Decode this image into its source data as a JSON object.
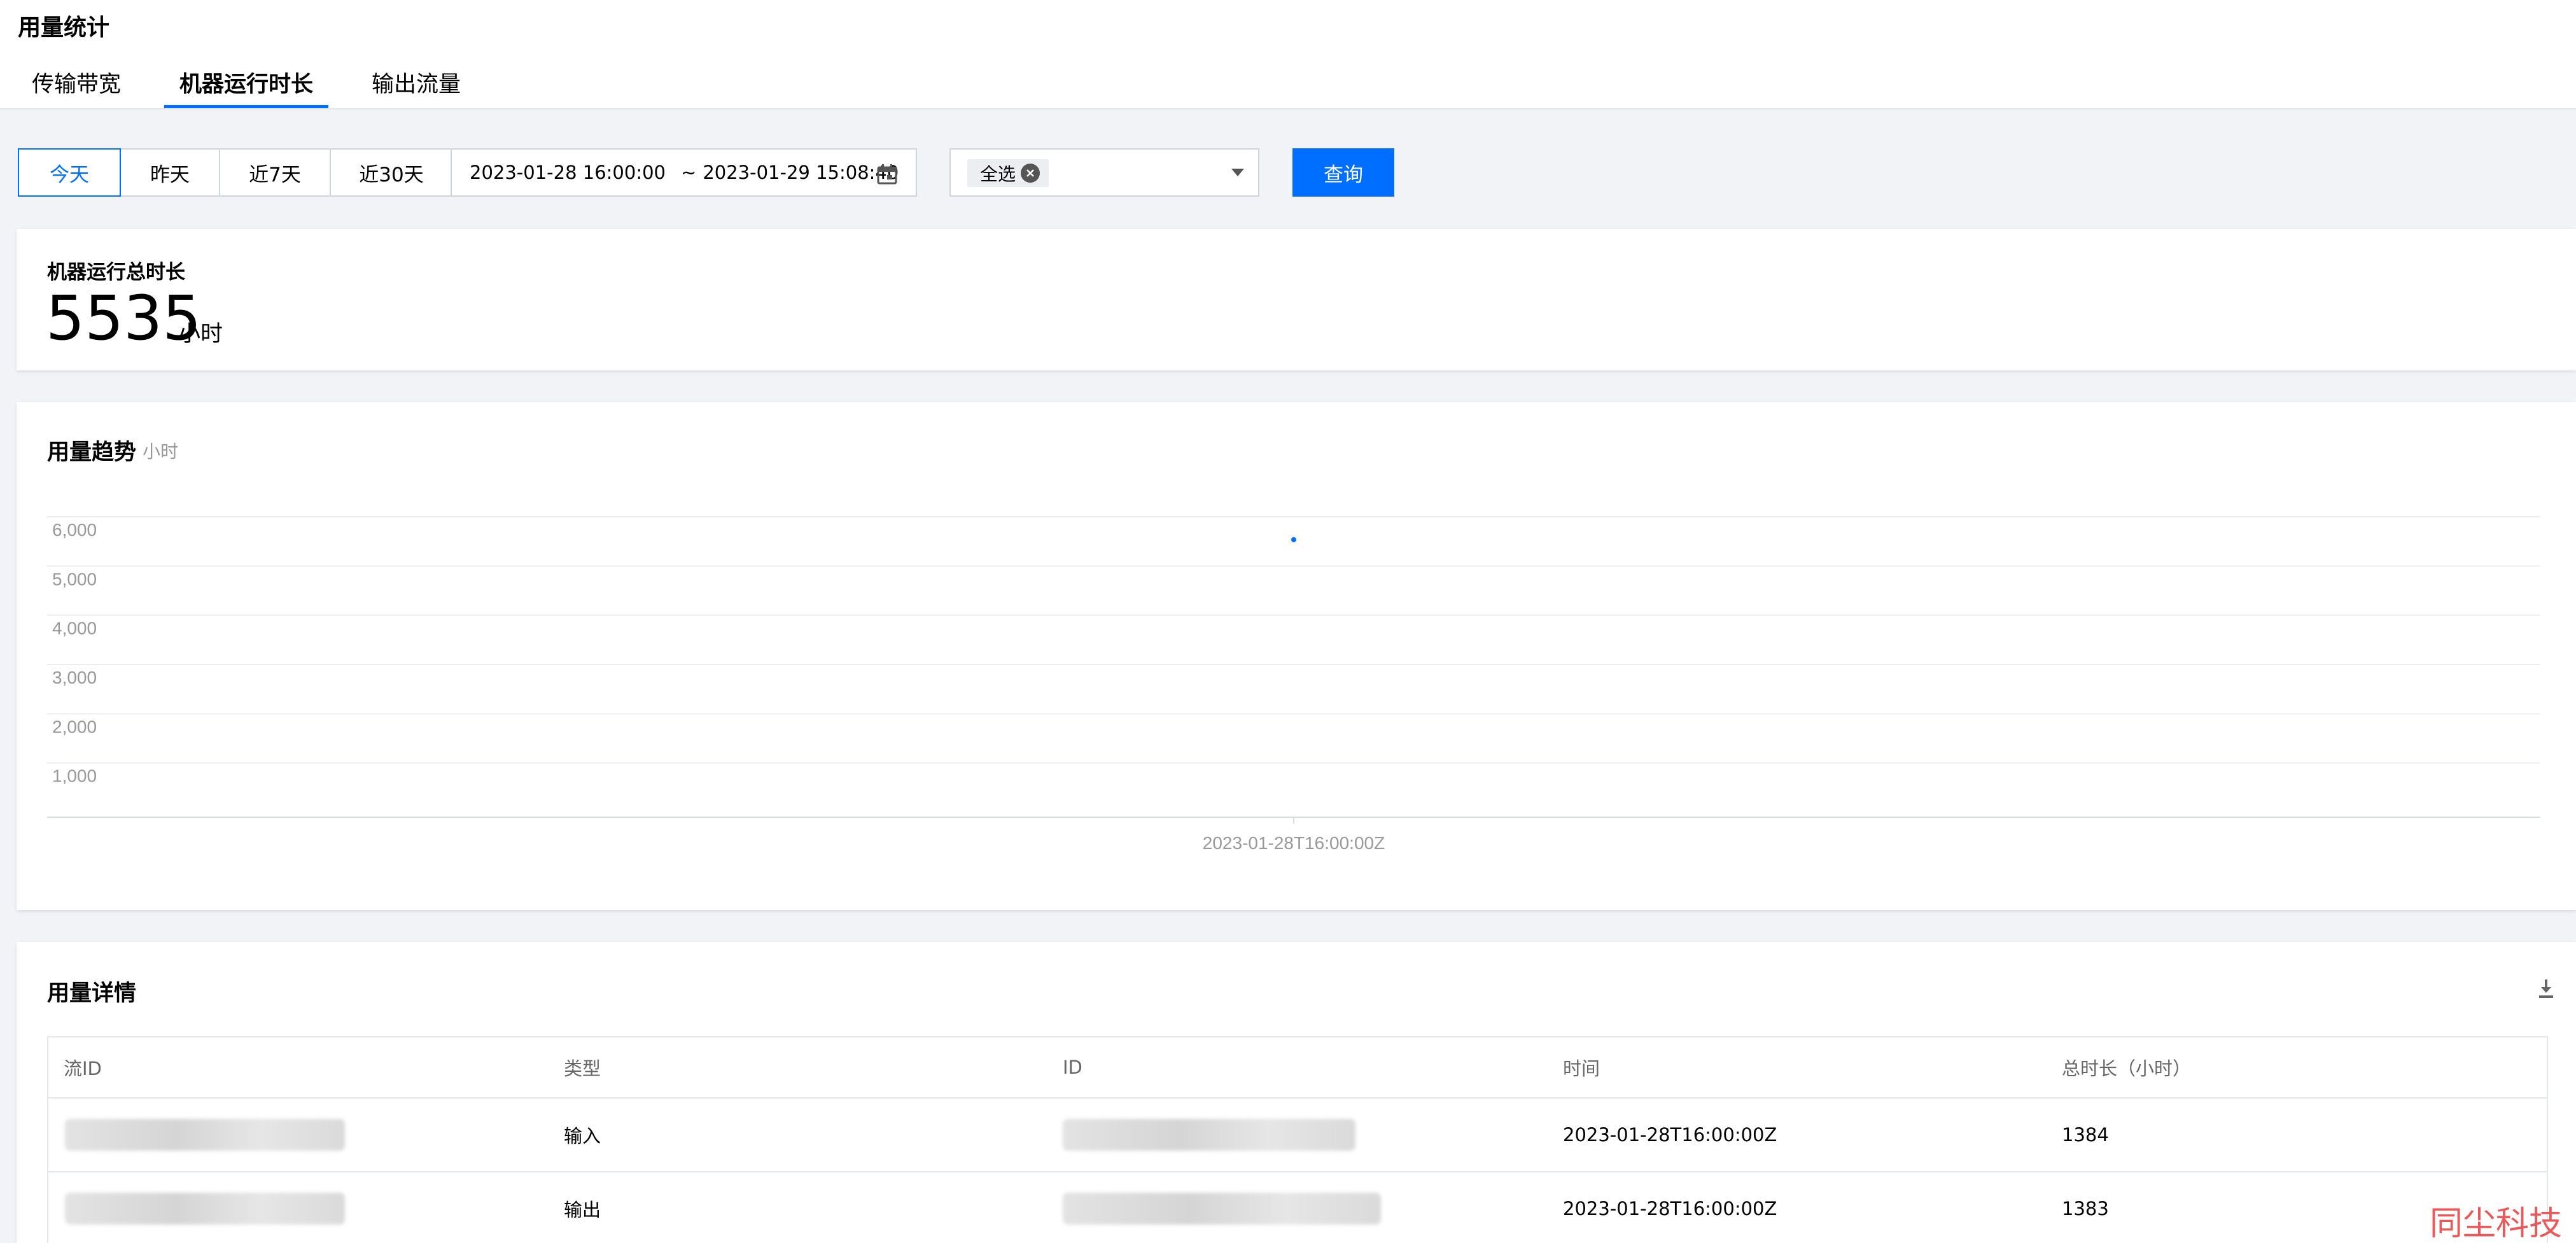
{
  "header": {
    "title": "用量统计",
    "tabs": [
      {
        "label": "传输带宽",
        "active": false
      },
      {
        "label": "机器运行时长",
        "active": true
      },
      {
        "label": "输出流量",
        "active": false
      }
    ]
  },
  "filters": {
    "quick_ranges": [
      {
        "label": "今天",
        "active": true
      },
      {
        "label": "昨天",
        "active": false
      },
      {
        "label": "近7天",
        "active": false
      },
      {
        "label": "近30天",
        "active": false
      }
    ],
    "date_start": "2023-01-28 16:00:00",
    "date_separator": "~",
    "date_end": "2023-01-29 15:08:40",
    "select_chip": "全选",
    "query_label": "查询"
  },
  "summary": {
    "label": "机器运行总时长",
    "value": "5535",
    "unit": "小时"
  },
  "trend": {
    "title": "用量趋势",
    "unit": "小时"
  },
  "chart_data": {
    "type": "scatter",
    "title": "用量趋势",
    "ylabel": "小时",
    "x": [
      "2023-01-28T16:00:00Z"
    ],
    "series": [
      {
        "values": [
          5535
        ]
      }
    ],
    "y_ticks": [
      "1,000",
      "2,000",
      "3,000",
      "4,000",
      "5,000",
      "6,000"
    ],
    "ylim": [
      0,
      6000
    ],
    "grid": true,
    "color": "#006eff"
  },
  "details": {
    "title": "用量详情",
    "columns": [
      "流ID",
      "类型",
      "ID",
      "时间",
      "总时长（小时）"
    ],
    "rows": [
      {
        "type": "输入",
        "time": "2023-01-28T16:00:00Z",
        "duration": "1384"
      },
      {
        "type": "输出",
        "time": "2023-01-28T16:00:00Z",
        "duration": "1383"
      }
    ]
  },
  "watermark": "同尘科技",
  "colors": {
    "accent": "#006eff",
    "background": "#f2f3f7",
    "border": "#cfd5de"
  }
}
